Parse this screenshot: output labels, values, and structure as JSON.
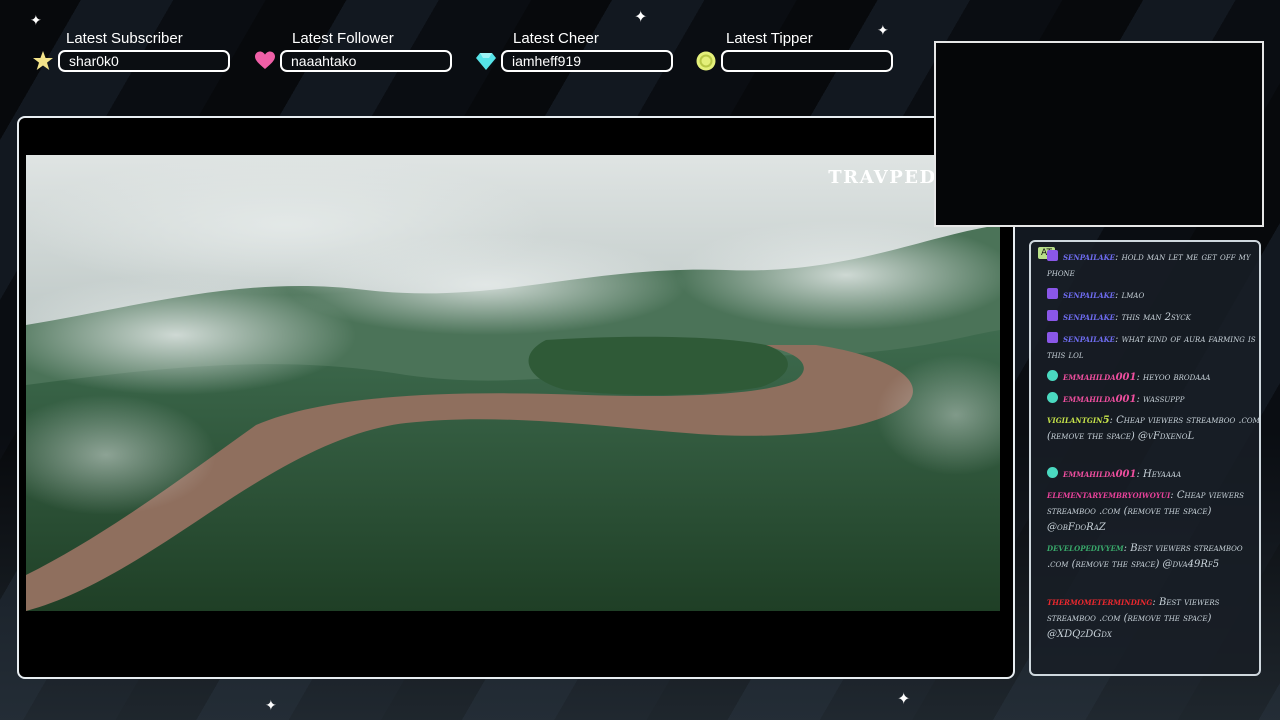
{
  "alerts": [
    {
      "label": "Latest Subscriber",
      "value": "shar0k0",
      "icon": "star-icon",
      "color": "#f3e38a"
    },
    {
      "label": "Latest Follower",
      "value": "naaahtako",
      "icon": "heart-icon",
      "color": "#ef5fa7"
    },
    {
      "label": "Latest Cheer",
      "value": "iamheff919",
      "icon": "gem-icon",
      "color": "#56e3e8"
    },
    {
      "label": "Latest Tipper",
      "value": "",
      "icon": "coin-icon",
      "color": "#e4f07a"
    }
  ],
  "video": {
    "watermark": "TRAVPEDIA"
  },
  "chat": {
    "tag": "AT",
    "messages": [
      {
        "user": "senpailake",
        "text": "hold man let me get off my phone",
        "badge": "sub",
        "color": "#6e6cf0"
      },
      {
        "user": "senpailake",
        "text": "lmao",
        "badge": "sub",
        "color": "#6e6cf0"
      },
      {
        "user": "senpailake",
        "text": "this man 2syck",
        "badge": "sub",
        "color": "#6e6cf0"
      },
      {
        "user": "senpailake",
        "text": "what kind of aura farming is this lol",
        "badge": "sub",
        "color": "#6e6cf0"
      },
      {
        "user": "emmahilda001",
        "text": "heyoo brodaaa",
        "badge": "gem",
        "color": "#ef4f9f"
      },
      {
        "user": "emmahilda001",
        "text": "wassuppp",
        "badge": "gem",
        "color": "#ef4f9f"
      },
      {
        "user": "vigilantgin5",
        "text": "Cheap viewers streamboo .com (remove the space) @vFdxenoL",
        "badge": "",
        "color": "#c6e34a"
      },
      {
        "user": "emmahilda001",
        "text": "Heyaaaa",
        "badge": "gem",
        "color": "#ef4f9f"
      },
      {
        "user": "elementaryembryoiwoyui",
        "text": "Cheap viewers streamboo .com (remove the space) @obFdoRaZ",
        "badge": "",
        "color": "#e8429a"
      },
      {
        "user": "developedivyem",
        "text": "Best viewers streamboo .com (remove the space) @dva49Rf5",
        "badge": "",
        "color": "#39a86a"
      },
      {
        "user": "thermometerminding",
        "text": "Best viewers streamboo .com (remove the space) @XDQzDGdx",
        "badge": "",
        "color": "#e8282e"
      }
    ]
  }
}
